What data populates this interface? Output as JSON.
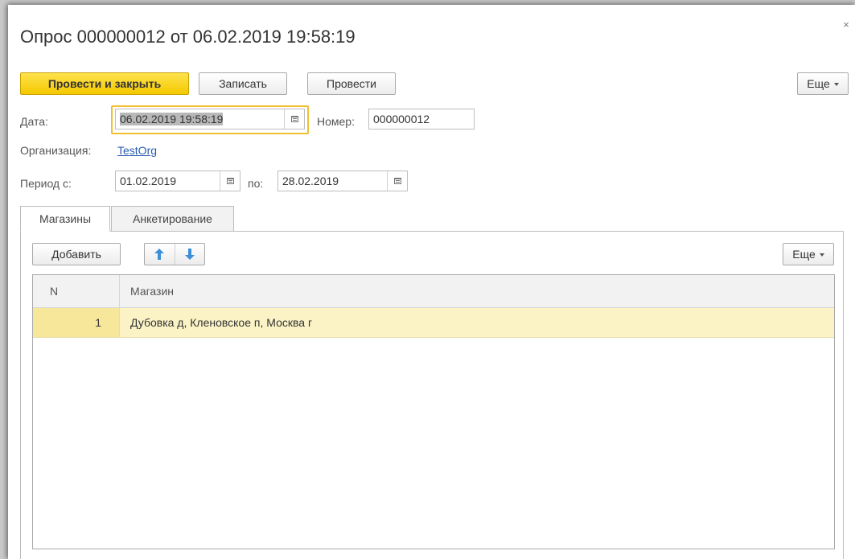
{
  "window": {
    "title": "Опрос 000000012 от 06.02.2019 19:58:19",
    "close_label": "×"
  },
  "toolbar": {
    "post_close_label": "Провести и закрыть",
    "write_label": "Записать",
    "post_label": "Провести",
    "more_label": "Еще"
  },
  "form": {
    "date_label": "Дата:",
    "date_value": "06.02.2019 19:58:19",
    "number_label": "Номер:",
    "number_value": "000000012",
    "org_label": "Организация:",
    "org_value": "TestOrg",
    "period_label": "Период  с:",
    "period_from": "01.02.2019",
    "period_to_label": "по:",
    "period_to": "28.02.2019"
  },
  "tabs": [
    {
      "label": "Магазины",
      "active": true
    },
    {
      "label": "Анкетирование",
      "active": false
    }
  ],
  "table_toolbar": {
    "add_label": "Добавить",
    "more_label": "Еще"
  },
  "table": {
    "columns": [
      "N",
      "Магазин"
    ],
    "rows": [
      {
        "n": "1",
        "shop": "Дубовка д, Кленовское п, Москва г"
      }
    ]
  },
  "colors": {
    "accent": "#f4c900",
    "focus_border": "#f0c030",
    "selected_row": "#fbf3c6",
    "link": "#2a5db0",
    "arrow_icon": "#3d8fd8"
  }
}
